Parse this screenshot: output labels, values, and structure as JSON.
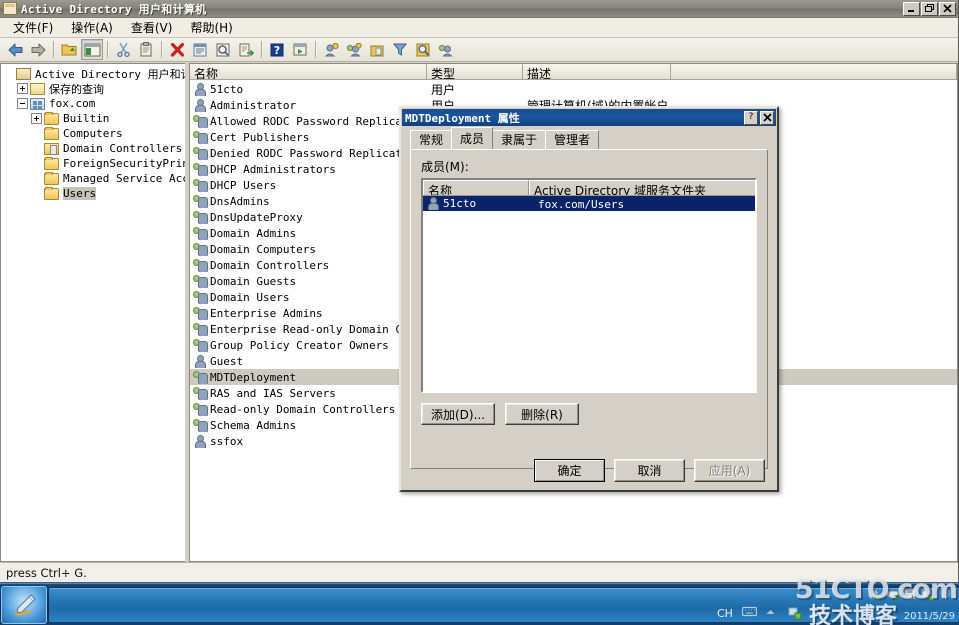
{
  "window": {
    "title": "Active Directory 用户和计算机",
    "icon": "console-icon",
    "buttons": [
      {
        "name": "minimize-button",
        "glyph": "–"
      },
      {
        "name": "restore-button",
        "glyph": "❐"
      },
      {
        "name": "close-button",
        "glyph": "✕"
      }
    ]
  },
  "menubar": {
    "items": [
      {
        "label": "文件(F)",
        "name": "menu-file"
      },
      {
        "label": "操作(A)",
        "name": "menu-action"
      },
      {
        "label": "查看(V)",
        "name": "menu-view"
      },
      {
        "label": "帮助(H)",
        "name": "menu-help"
      }
    ]
  },
  "toolbar": {
    "buttons": [
      {
        "name": "back-icon",
        "kind": "arrow-left"
      },
      {
        "name": "forward-icon",
        "kind": "arrow-right"
      },
      {
        "name": "up-one-level-icon",
        "kind": "folder-up"
      },
      {
        "name": "show-hide-console-tree-icon",
        "kind": "console-tree",
        "pressed": true
      },
      {
        "name": "cut-icon",
        "kind": "scissors"
      },
      {
        "name": "copy-icon",
        "kind": "clipboard"
      },
      {
        "name": "delete-icon",
        "kind": "red-x"
      },
      {
        "name": "properties-icon",
        "kind": "properties"
      },
      {
        "name": "refresh-icon",
        "kind": "refresh"
      },
      {
        "name": "export-list-icon",
        "kind": "export"
      },
      {
        "name": "help-icon",
        "kind": "question"
      },
      {
        "name": "show-group-icon",
        "kind": "window-green"
      },
      {
        "name": "new-user-icon",
        "kind": "user-new"
      },
      {
        "name": "new-group-icon",
        "kind": "group-new"
      },
      {
        "name": "new-ou-icon",
        "kind": "ou-new"
      },
      {
        "name": "filter-icon",
        "kind": "funnel"
      },
      {
        "name": "find-icon",
        "kind": "find"
      },
      {
        "name": "saved-query-icon",
        "kind": "user-query"
      }
    ]
  },
  "tree": {
    "nodes": [
      {
        "label": "Active Directory 用户和计算机",
        "indent": 0,
        "expander": "none",
        "icon": "console",
        "selected": false,
        "name": "tree-root-adsi"
      },
      {
        "label": "保存的查询",
        "indent": 1,
        "expander": "plus",
        "icon": "query",
        "selected": false,
        "name": "tree-saved-queries"
      },
      {
        "label": "fox.com",
        "indent": 1,
        "expander": "minus",
        "icon": "domain",
        "selected": false,
        "name": "tree-domain-foxcom"
      },
      {
        "label": "Builtin",
        "indent": 2,
        "expander": "plus",
        "icon": "folder",
        "selected": false,
        "name": "tree-builtin"
      },
      {
        "label": "Computers",
        "indent": 2,
        "expander": "none",
        "icon": "folder",
        "selected": false,
        "name": "tree-computers"
      },
      {
        "label": "Domain Controllers",
        "indent": 2,
        "expander": "none",
        "icon": "folderspec",
        "selected": false,
        "name": "tree-domain-controllers"
      },
      {
        "label": "ForeignSecurityPrincipals",
        "indent": 2,
        "expander": "none",
        "icon": "folder",
        "selected": false,
        "name": "tree-foreign-security-principals"
      },
      {
        "label": "Managed Service Accounts",
        "indent": 2,
        "expander": "none",
        "icon": "folder",
        "selected": false,
        "name": "tree-managed-service-accounts"
      },
      {
        "label": "Users",
        "indent": 2,
        "expander": "none",
        "icon": "folder",
        "selected": true,
        "name": "tree-users"
      }
    ]
  },
  "listview": {
    "columns": [
      {
        "label": "名称",
        "name": "column-name"
      },
      {
        "label": "类型",
        "name": "column-type"
      },
      {
        "label": "描述",
        "name": "column-description"
      },
      {
        "label": "",
        "name": "column-filler"
      }
    ],
    "rows": [
      {
        "name": "51cto",
        "type": "用户",
        "desc": "",
        "icon": "user",
        "selected": false
      },
      {
        "name": "Administrator",
        "type": "用户",
        "desc": "管理计算机(域)的内置帐户",
        "icon": "user",
        "selected": false
      },
      {
        "name": "Allowed RODC Password Replication Group",
        "type": "",
        "desc": "",
        "icon": "group",
        "selected": false
      },
      {
        "name": "Cert Publishers",
        "type": "",
        "desc": "",
        "icon": "group",
        "selected": false
      },
      {
        "name": "Denied RODC Password Replication Group",
        "type": "",
        "desc": "",
        "icon": "group",
        "selected": false
      },
      {
        "name": "DHCP Administrators",
        "type": "",
        "desc": "",
        "icon": "group",
        "selected": false
      },
      {
        "name": "DHCP Users",
        "type": "",
        "desc": "",
        "icon": "group",
        "selected": false
      },
      {
        "name": "DnsAdmins",
        "type": "",
        "desc": "",
        "icon": "group",
        "selected": false
      },
      {
        "name": "DnsUpdateProxy",
        "type": "",
        "desc": "",
        "icon": "group",
        "selected": false
      },
      {
        "name": "Domain Admins",
        "type": "",
        "desc": "",
        "icon": "group",
        "selected": false
      },
      {
        "name": "Domain Computers",
        "type": "",
        "desc": "",
        "icon": "group",
        "selected": false
      },
      {
        "name": "Domain Controllers",
        "type": "",
        "desc": "",
        "icon": "group",
        "selected": false
      },
      {
        "name": "Domain Guests",
        "type": "",
        "desc": "",
        "icon": "group",
        "selected": false
      },
      {
        "name": "Domain Users",
        "type": "",
        "desc": "",
        "icon": "group",
        "selected": false
      },
      {
        "name": "Enterprise Admins",
        "type": "",
        "desc": "",
        "icon": "group",
        "selected": false
      },
      {
        "name": "Enterprise Read-only Domain Controllers",
        "type": "",
        "desc": "",
        "icon": "group",
        "selected": false
      },
      {
        "name": "Group Policy Creator Owners",
        "type": "",
        "desc": "",
        "icon": "group",
        "selected": false
      },
      {
        "name": "Guest",
        "type": "",
        "desc": "",
        "icon": "user",
        "selected": false
      },
      {
        "name": "MDTDeployment",
        "type": "",
        "desc": "",
        "icon": "group",
        "selected": true
      },
      {
        "name": "RAS and IAS Servers",
        "type": "",
        "desc": "",
        "icon": "group",
        "selected": false
      },
      {
        "name": "Read-only Domain Controllers",
        "type": "",
        "desc": "",
        "icon": "group",
        "selected": false
      },
      {
        "name": "Schema Admins",
        "type": "",
        "desc": "",
        "icon": "group",
        "selected": false
      },
      {
        "name": "ssfox",
        "type": "",
        "desc": "",
        "icon": "user",
        "selected": false
      }
    ]
  },
  "statusbar": {
    "text": "press Ctrl+ G."
  },
  "dialog": {
    "title_object": "MDTDeployment",
    "title_suffix": "属性",
    "help_button": "?",
    "close_button": "✕",
    "tabs": [
      {
        "label": "常规",
        "name": "tab-general",
        "active": false
      },
      {
        "label": "成员",
        "name": "tab-members",
        "active": true
      },
      {
        "label": "隶属于",
        "name": "tab-member-of",
        "active": false
      },
      {
        "label": "管理者",
        "name": "tab-managed-by",
        "active": false
      }
    ],
    "members_label": "成员(M):",
    "member_columns": [
      {
        "label": "名称",
        "name": "member-column-name"
      },
      {
        "label": "Active Directory 域服务文件夹",
        "name": "member-column-folder"
      }
    ],
    "members": [
      {
        "name": "51cto",
        "folder": "fox.com/Users",
        "selected": true,
        "icon": "user"
      }
    ],
    "add_button": "添加(D)...",
    "remove_button": "删除(R)",
    "ok_button": "确定",
    "cancel_button": "取消",
    "apply_button": "应用(A)"
  },
  "taskbar": {
    "start_icon": "start-orb",
    "quicklaunch_icon": "paint-pen-icon",
    "tray_icons": [
      {
        "name": "network-icon"
      },
      {
        "name": "removable-media-icon"
      },
      {
        "name": "save-disk-icon"
      },
      {
        "name": "server-manager-icon"
      },
      {
        "name": "shield-icon"
      }
    ],
    "input_language": "CH",
    "ime_keyboard": "keyboard-icon",
    "show_hidden_icons": "chevron-up-icon",
    "action_center": "flag-icon",
    "date": "2011/5/29"
  },
  "watermark": {
    "site": "51CTO.com",
    "tagline": "技术博客"
  }
}
